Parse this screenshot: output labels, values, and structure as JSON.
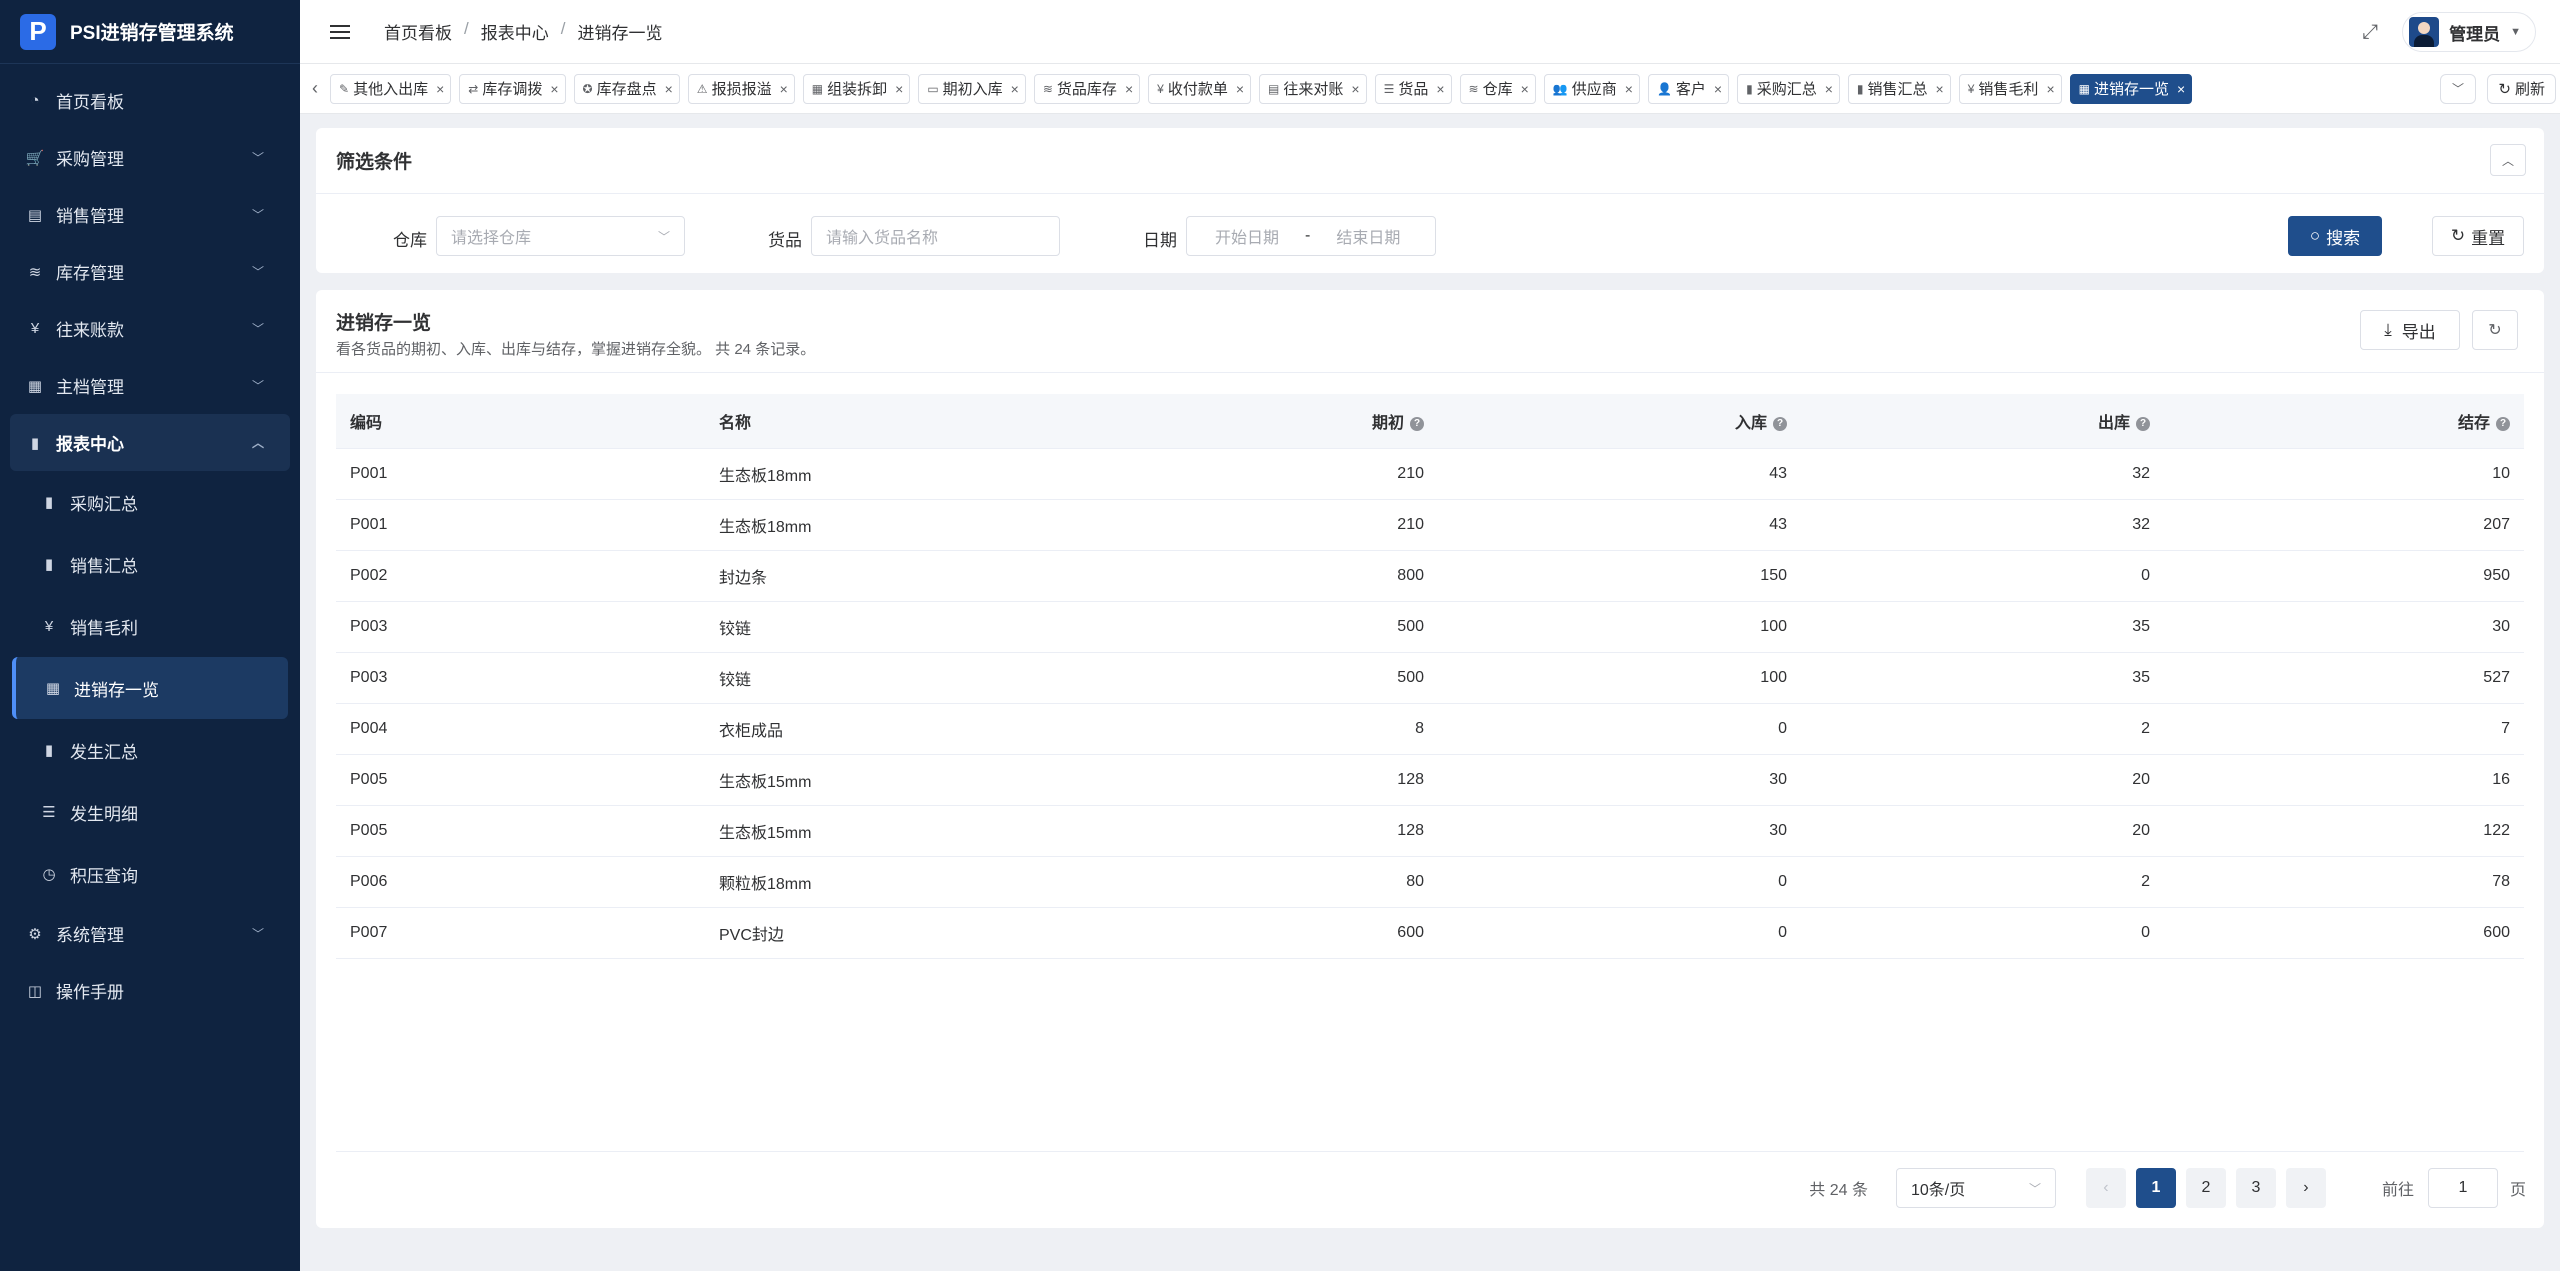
{
  "app": {
    "title": "PSI进销存管理系统",
    "logo_letter": "P"
  },
  "sidebar": {
    "items": [
      {
        "label": "首页看板",
        "icon": "dashboard-icon",
        "glyph": "◔",
        "expandable": false
      },
      {
        "label": "采购管理",
        "icon": "cart-icon",
        "glyph": "🛒",
        "expandable": true
      },
      {
        "label": "销售管理",
        "icon": "sales-icon",
        "glyph": "▤",
        "expandable": true
      },
      {
        "label": "库存管理",
        "icon": "stack-icon",
        "glyph": "≋",
        "expandable": true
      },
      {
        "label": "往来账款",
        "icon": "yen-icon",
        "glyph": "¥",
        "expandable": true
      },
      {
        "label": "主档管理",
        "icon": "archive-icon",
        "glyph": "▦",
        "expandable": true
      },
      {
        "label": "报表中心",
        "icon": "bar-chart-icon",
        "glyph": "▮",
        "expandable": true,
        "open": true
      }
    ],
    "report_sub_items": [
      {
        "label": "采购汇总",
        "icon": "bar-chart-icon",
        "glyph": "▮"
      },
      {
        "label": "销售汇总",
        "icon": "bar-chart-icon",
        "glyph": "▮"
      },
      {
        "label": "销售毛利",
        "icon": "yen-icon",
        "glyph": "¥"
      },
      {
        "label": "进销存一览",
        "icon": "table-icon",
        "glyph": "▦",
        "active": true
      },
      {
        "label": "发生汇总",
        "icon": "bar-chart-icon",
        "glyph": "▮"
      },
      {
        "label": "发生明细",
        "icon": "list-icon",
        "glyph": "☰"
      },
      {
        "label": "积压查询",
        "icon": "clock-icon",
        "glyph": "◷"
      }
    ],
    "bottom_items": [
      {
        "label": "系统管理",
        "icon": "gear-icon",
        "glyph": "⚙",
        "expandable": true
      },
      {
        "label": "操作手册",
        "icon": "book-icon",
        "glyph": "◫",
        "expandable": false
      }
    ]
  },
  "header": {
    "breadcrumb": [
      "首页看板",
      "报表中心",
      "进销存一览"
    ],
    "user_name": "管理员"
  },
  "tabs": [
    {
      "label": "其他入出库",
      "icon": "edit-icon",
      "glyph": "✎"
    },
    {
      "label": "库存调拨",
      "icon": "transfer-icon",
      "glyph": "⇄"
    },
    {
      "label": "库存盘点",
      "icon": "check-icon",
      "glyph": "✪"
    },
    {
      "label": "报损报溢",
      "icon": "alert-icon",
      "glyph": "⚠"
    },
    {
      "label": "组装拆卸",
      "icon": "grid-icon",
      "glyph": "▦"
    },
    {
      "label": "期初入库",
      "icon": "calendar-icon",
      "glyph": "▭"
    },
    {
      "label": "货品库存",
      "icon": "stack-icon",
      "glyph": "≋"
    },
    {
      "label": "收付款单",
      "icon": "yen-icon",
      "glyph": "¥"
    },
    {
      "label": "往来对账",
      "icon": "doc-icon",
      "glyph": "▤"
    },
    {
      "label": "货品",
      "icon": "list-icon",
      "glyph": "☰"
    },
    {
      "label": "仓库",
      "icon": "stack-icon",
      "glyph": "≋"
    },
    {
      "label": "供应商",
      "icon": "users-icon",
      "glyph": "👥"
    },
    {
      "label": "客户",
      "icon": "user-icon",
      "glyph": "👤"
    },
    {
      "label": "采购汇总",
      "icon": "bar-chart-icon",
      "glyph": "▮"
    },
    {
      "label": "销售汇总",
      "icon": "bar-chart-icon",
      "glyph": "▮"
    },
    {
      "label": "销售毛利",
      "icon": "yen-icon",
      "glyph": "¥"
    },
    {
      "label": "进销存一览",
      "icon": "table-icon",
      "glyph": "▦",
      "active": true
    }
  ],
  "tabs_refresh_label": "刷新",
  "filter": {
    "title": "筛选条件",
    "warehouse_label": "仓库",
    "warehouse_placeholder": "请选择仓库",
    "goods_label": "货品",
    "goods_placeholder": "请输入货品名称",
    "date_label": "日期",
    "date_start_placeholder": "开始日期",
    "date_sep": "-",
    "date_end_placeholder": "结束日期",
    "search_label": "搜索",
    "reset_label": "重置"
  },
  "table": {
    "title": "进销存一览",
    "description": "看各货品的期初、入库、出库与结存，掌握进销存全貌。 共 24 条记录。",
    "export_label": "导出",
    "columns": [
      "编码",
      "名称",
      "期初",
      "入库",
      "出库",
      "结存"
    ],
    "rows": [
      [
        "P001",
        "生态板18mm",
        "210",
        "43",
        "32",
        "10"
      ],
      [
        "P001",
        "生态板18mm",
        "210",
        "43",
        "32",
        "207"
      ],
      [
        "P002",
        "封边条",
        "800",
        "150",
        "0",
        "950"
      ],
      [
        "P003",
        "铰链",
        "500",
        "100",
        "35",
        "30"
      ],
      [
        "P003",
        "铰链",
        "500",
        "100",
        "35",
        "527"
      ],
      [
        "P004",
        "衣柜成品",
        "8",
        "0",
        "2",
        "7"
      ],
      [
        "P005",
        "生态板15mm",
        "128",
        "30",
        "20",
        "16"
      ],
      [
        "P005",
        "生态板15mm",
        "128",
        "30",
        "20",
        "122"
      ],
      [
        "P006",
        "颗粒板18mm",
        "80",
        "0",
        "2",
        "78"
      ],
      [
        "P007",
        "PVC封边",
        "600",
        "0",
        "0",
        "600"
      ]
    ]
  },
  "pagination": {
    "total_text": "共 24 条",
    "page_size": "10条/页",
    "pages": [
      "1",
      "2",
      "3"
    ],
    "current_page": "1",
    "goto_label": "前往",
    "goto_value": "1",
    "page_suffix": "页"
  },
  "colors": {
    "sidebar_bg": "#0f2340",
    "primary": "#1f4e8c",
    "active_indicator": "#4f8ff7"
  }
}
